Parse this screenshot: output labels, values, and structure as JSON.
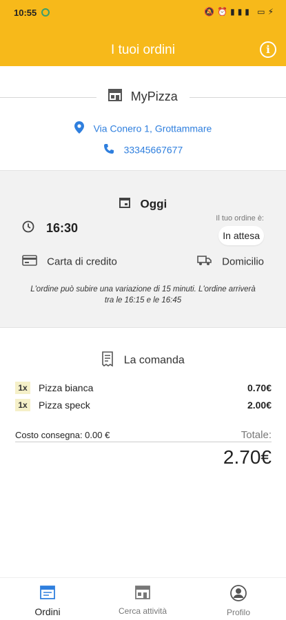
{
  "status_bar": {
    "time": "10:55"
  },
  "app_bar": {
    "title": "I tuoi ordini",
    "info_icon": "info-icon"
  },
  "shop": {
    "name": "MyPizza",
    "address": "Via Conero 1, Grottammare",
    "phone": "33345667677",
    "accent_color": "#2f7fde"
  },
  "order": {
    "date_label": "Oggi",
    "time": "16:30",
    "status_label": "Il tuo ordine è:",
    "status_value": "In attesa",
    "payment": "Carta di credito",
    "delivery": "Domicilio",
    "note": "L'ordine può subire una variazione di 15 minuti. L'ordine arriverà tra le 16:15 e le 16:45"
  },
  "comanda": {
    "title": "La comanda",
    "items": [
      {
        "qty": "1x",
        "name": "Pizza bianca",
        "price": "0.70€"
      },
      {
        "qty": "1x",
        "name": "Pizza speck",
        "price": "2.00€"
      }
    ],
    "delivery_cost": "Costo consegna: 0.00 €",
    "total_label": "Totale:",
    "total_value": "2.70€"
  },
  "tabs": [
    {
      "label": "Ordini",
      "active": true
    },
    {
      "label": "Cerca attività",
      "active": false
    },
    {
      "label": "Profilo",
      "active": false
    }
  ],
  "colors": {
    "primary": "#f7b91a",
    "link": "#2f7fde"
  }
}
